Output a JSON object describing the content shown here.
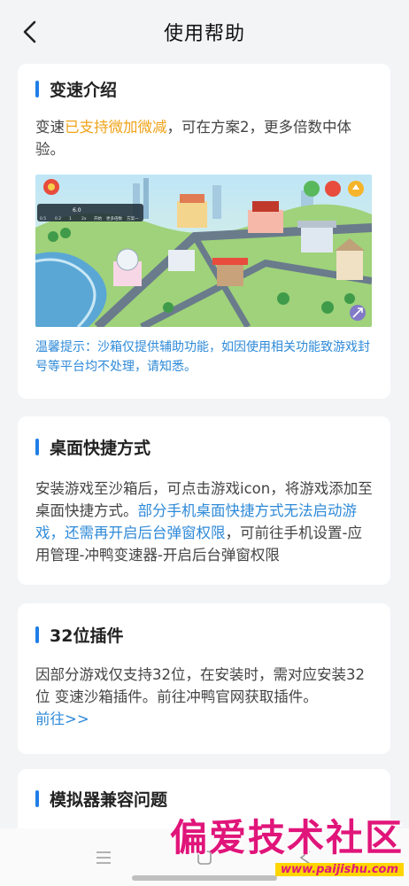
{
  "header": {
    "title": "使用帮助"
  },
  "colors": {
    "accent": "#1f7fe6",
    "highlight": "#f0a319",
    "tip": "#2e8ad8",
    "watermark": "#e0157a"
  },
  "cards": [
    {
      "title": "变速介绍",
      "body_pre": "变速",
      "body_highlight": "已支持微加微减",
      "body_post": "，可在方案2，更多倍数中体验。",
      "banner_speed_label": "6.0",
      "banner_hud": [
        "0.5",
        "0.2",
        "1",
        "2x",
        "开始",
        "更多倍数",
        "方案一"
      ],
      "tip": "温馨提示：沙箱仅提供辅助功能，如因使用相关功能致游戏封号等平台均不处理，请知悉。"
    },
    {
      "title": "桌面快捷方式",
      "body_pre": "安装游戏至沙箱后，可点击游戏icon，将游戏添加至桌面快捷方式。",
      "body_highlight": "部分手机桌面快捷方式无法启动游戏，还需再开启后台弹窗权限",
      "body_post": "，可前往手机设置-应用管理-冲鸭变速器-开启后台弹窗权限"
    },
    {
      "title": "32位插件",
      "body": "因部分游戏仅支持32位，在安装时，需对应安装32位 变速沙箱插件。前往冲鸭官网获取插件。",
      "link": "前往>>"
    },
    {
      "title": "模拟器兼容问题"
    }
  ],
  "watermark": {
    "title": "偏爱技术社区",
    "url": "www.paijishu.com"
  }
}
